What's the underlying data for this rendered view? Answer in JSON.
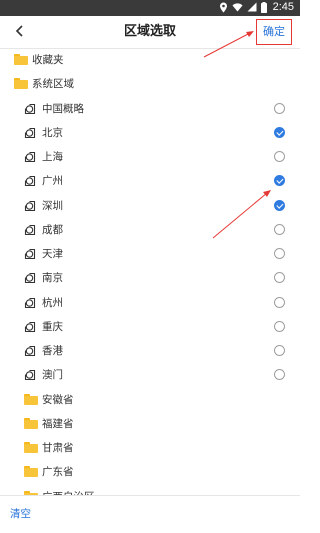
{
  "status": {
    "time": "2:45"
  },
  "header": {
    "title": "区域选取",
    "confirm_label": "确定"
  },
  "tree": {
    "favorites": {
      "label": "收藏夹"
    },
    "system": {
      "label": "系统区域"
    },
    "regions": [
      {
        "label": "中国概略",
        "checked": false
      },
      {
        "label": "北京",
        "checked": true
      },
      {
        "label": "上海",
        "checked": false
      },
      {
        "label": "广州",
        "checked": true
      },
      {
        "label": "深圳",
        "checked": true
      },
      {
        "label": "成都",
        "checked": false
      },
      {
        "label": "天津",
        "checked": false
      },
      {
        "label": "南京",
        "checked": false
      },
      {
        "label": "杭州",
        "checked": false
      },
      {
        "label": "重庆",
        "checked": false
      },
      {
        "label": "香港",
        "checked": false
      },
      {
        "label": "澳门",
        "checked": false
      }
    ],
    "provinces": [
      {
        "label": "安徽省"
      },
      {
        "label": "福建省"
      },
      {
        "label": "甘肃省"
      },
      {
        "label": "广东省"
      },
      {
        "label": "广西自治区"
      }
    ]
  },
  "footer": {
    "clear_label": "清空"
  },
  "colors": {
    "accent": "#2f7be0",
    "annotation": "#e53935",
    "folder": "#f8c53a"
  }
}
